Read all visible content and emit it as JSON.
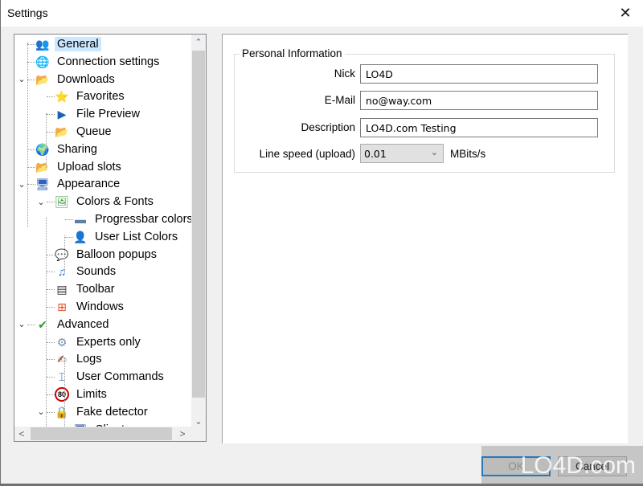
{
  "window": {
    "title": "Settings",
    "close_label": "✕"
  },
  "tree": {
    "items": [
      {
        "label": "General",
        "icon": "users-icon",
        "glyph": "👥",
        "level": 0,
        "selected": true,
        "expanded": null
      },
      {
        "label": "Connection settings",
        "icon": "globe-network-icon",
        "glyph": "🌐",
        "level": 0,
        "selected": false,
        "expanded": null
      },
      {
        "label": "Downloads",
        "icon": "download-folder-icon",
        "glyph": "📂",
        "level": 0,
        "selected": false,
        "expanded": true
      },
      {
        "label": "Favorites",
        "icon": "favorites-folder-icon",
        "glyph": "⭐",
        "level": 1,
        "selected": false,
        "expanded": null
      },
      {
        "label": "File Preview",
        "icon": "media-play-icon",
        "glyph": "▶",
        "level": 1,
        "selected": false,
        "expanded": null
      },
      {
        "label": "Queue",
        "icon": "queue-folder-icon",
        "glyph": "📂",
        "level": 1,
        "selected": false,
        "expanded": null
      },
      {
        "label": "Sharing",
        "icon": "sharing-globe-icon",
        "glyph": "🌍",
        "level": 0,
        "selected": false,
        "expanded": null
      },
      {
        "label": "Upload slots",
        "icon": "upload-folder-icon",
        "glyph": "📂",
        "level": 0,
        "selected": false,
        "expanded": null
      },
      {
        "label": "Appearance",
        "icon": "monitor-colors-icon",
        "glyph": "🖥",
        "level": 0,
        "selected": false,
        "expanded": true
      },
      {
        "label": "Colors & Fonts",
        "icon": "picture-icon",
        "glyph": "🖼",
        "level": 1,
        "selected": false,
        "expanded": true
      },
      {
        "label": "Progressbar colors",
        "icon": "progressbar-icon",
        "glyph": "▬",
        "level": 2,
        "selected": false,
        "expanded": null
      },
      {
        "label": "User List Colors",
        "icon": "user-icon",
        "glyph": "👤",
        "level": 2,
        "selected": false,
        "expanded": null
      },
      {
        "label": "Balloon popups",
        "icon": "balloon-icon",
        "glyph": "💬",
        "level": 1,
        "selected": false,
        "expanded": null
      },
      {
        "label": "Sounds",
        "icon": "music-note-icon",
        "glyph": "♫",
        "level": 1,
        "selected": false,
        "expanded": null
      },
      {
        "label": "Toolbar",
        "icon": "toolbar-icon",
        "glyph": "▤",
        "level": 1,
        "selected": false,
        "expanded": null
      },
      {
        "label": "Windows",
        "icon": "windows-logo-icon",
        "glyph": "⊞",
        "level": 1,
        "selected": false,
        "expanded": null
      },
      {
        "label": "Advanced",
        "icon": "checkmark-monitor-icon",
        "glyph": "✔",
        "level": 0,
        "selected": false,
        "expanded": true
      },
      {
        "label": "Experts only",
        "icon": "gear-icon",
        "glyph": "⚙",
        "level": 1,
        "selected": false,
        "expanded": null
      },
      {
        "label": "Logs",
        "icon": "pen-logs-icon",
        "glyph": "✍",
        "level": 1,
        "selected": false,
        "expanded": null
      },
      {
        "label": "User Commands",
        "icon": "text-cursor-icon",
        "glyph": "⌶",
        "level": 1,
        "selected": false,
        "expanded": null
      },
      {
        "label": "Limits",
        "icon": "speed-limit-80-icon",
        "glyph": "80",
        "level": 1,
        "selected": false,
        "expanded": null
      },
      {
        "label": "Fake detector",
        "icon": "padlock-icon",
        "glyph": "🔒",
        "level": 1,
        "selected": false,
        "expanded": true
      },
      {
        "label": "Clients",
        "icon": "clients-icon",
        "glyph": "🖥",
        "level": 2,
        "selected": false,
        "expanded": null
      }
    ],
    "scroll_up": "⌃",
    "scroll_down": "⌄",
    "scroll_left": "<",
    "scroll_right": ">"
  },
  "personal_info": {
    "group_title": "Personal Information",
    "nick_label": "Nick",
    "nick_value": "LO4D",
    "email_label": "E-Mail",
    "email_value": "no@way.com",
    "description_label": "Description",
    "description_value": "LO4D.com Testing",
    "line_speed_label": "Line speed (upload)",
    "line_speed_value": "0.01",
    "line_speed_units": "MBits/s"
  },
  "buttons": {
    "ok": "OK",
    "cancel": "Cancel"
  },
  "watermark": "LO4D.com"
}
